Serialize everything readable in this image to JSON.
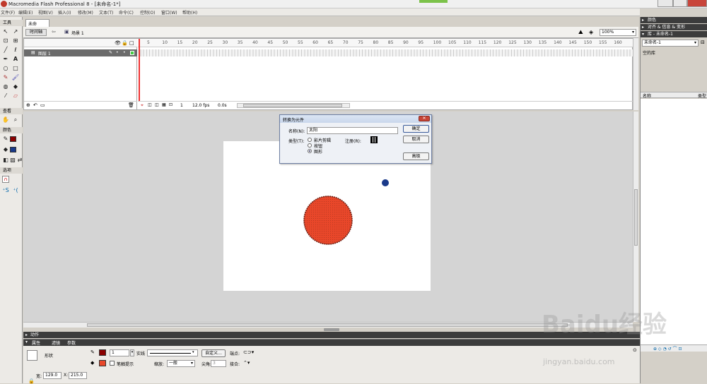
{
  "window": {
    "title": "Macromedia Flash Professional 8 - [未命名-1*]"
  },
  "menu": [
    "文件(F)",
    "编辑(E)",
    "视图(V)",
    "插入(I)",
    "修改(M)",
    "文本(T)",
    "命令(C)",
    "控制(O)",
    "窗口(W)",
    "帮助(H)"
  ],
  "tools": {
    "header": "工具",
    "view_header": "查看",
    "color_header": "颜色",
    "options_header": "选项"
  },
  "document": {
    "tab": "未命名-1*",
    "timeline_button": "时间轴",
    "scene": "场景 1",
    "zoom": "100%"
  },
  "timeline": {
    "layer_name": "图层 1",
    "frame_numbers": [
      "5",
      "10",
      "15",
      "20",
      "25",
      "30",
      "35",
      "40",
      "45",
      "50",
      "55",
      "60",
      "65",
      "70",
      "75",
      "80",
      "85",
      "90",
      "95",
      "100",
      "105",
      "110",
      "115",
      "120",
      "125",
      "130",
      "135",
      "140",
      "145",
      "150",
      "155",
      "160"
    ],
    "current_frame": "1",
    "fps": "12.0 fps",
    "time": "0.0s"
  },
  "dialog": {
    "title": "转换为元件",
    "name_label": "名称(N):",
    "name_value": "太阳",
    "type_label": "类型(T):",
    "types": [
      "影片剪辑",
      "按钮",
      "图形"
    ],
    "selected_type": 2,
    "registration_label": "注册(R):",
    "ok": "确定",
    "cancel": "取消",
    "advanced": "高级"
  },
  "stage_colors": {
    "circle_fill": "#e8472a",
    "circle_stroke": "#6b1c10",
    "dot": "#1a3a8a"
  },
  "panels": {
    "actions": "动作",
    "props_tabs": [
      "属性",
      "滤镜",
      "参数"
    ],
    "props": {
      "shape_label": "形状",
      "stroke_width": "1",
      "stroke_style": "实线",
      "custom_button": "自定义...",
      "cap_label": "端点:",
      "hint_label": "笔触提示",
      "scale_label": "缩放:",
      "scale_value": "一般",
      "miter_label": "尖角:",
      "miter_value": "3",
      "join_label": "接合:",
      "w_label": "宽:",
      "w_value": "129.0",
      "x_label": "X:",
      "x_value": "215.0"
    }
  },
  "right_panels": {
    "color": "颜色",
    "align": "对齐 & 信息 & 变形",
    "library": "库 - 未命名-1",
    "library_doc": "未命名-1",
    "empty_library": "空的库",
    "col_name": "名称",
    "col_type": "类型"
  },
  "watermark": {
    "text": "Baidu经验",
    "url": "jingyan.baidu.com"
  }
}
